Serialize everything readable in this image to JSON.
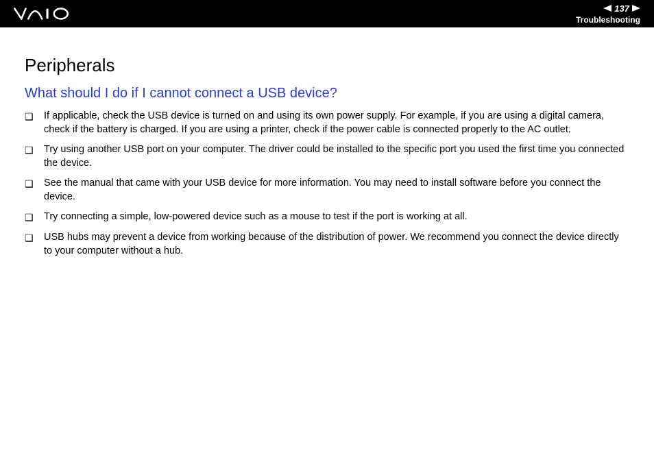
{
  "header": {
    "page_number": "137",
    "section_label": "Troubleshooting"
  },
  "content": {
    "section_title": "Peripherals",
    "question": "What should I do if I cannot connect a USB device?",
    "bullets": [
      "If applicable, check the USB device is turned on and using its own power supply. For example, if you are using a digital camera, check if the battery is charged. If you are using a printer, check if the power cable is connected properly to the AC outlet.",
      "Try using another USB port on your computer. The driver could be installed to the specific port you used the first time you connected the device.",
      "See the manual that came with your USB device for more information. You may need to install software before you connect the device.",
      "Try connecting a simple, low-powered device such as a mouse to test if the port is working at all.",
      "USB hubs may prevent a device from working because of the distribution of power. We recommend you connect the device directly to your computer without a hub."
    ]
  }
}
